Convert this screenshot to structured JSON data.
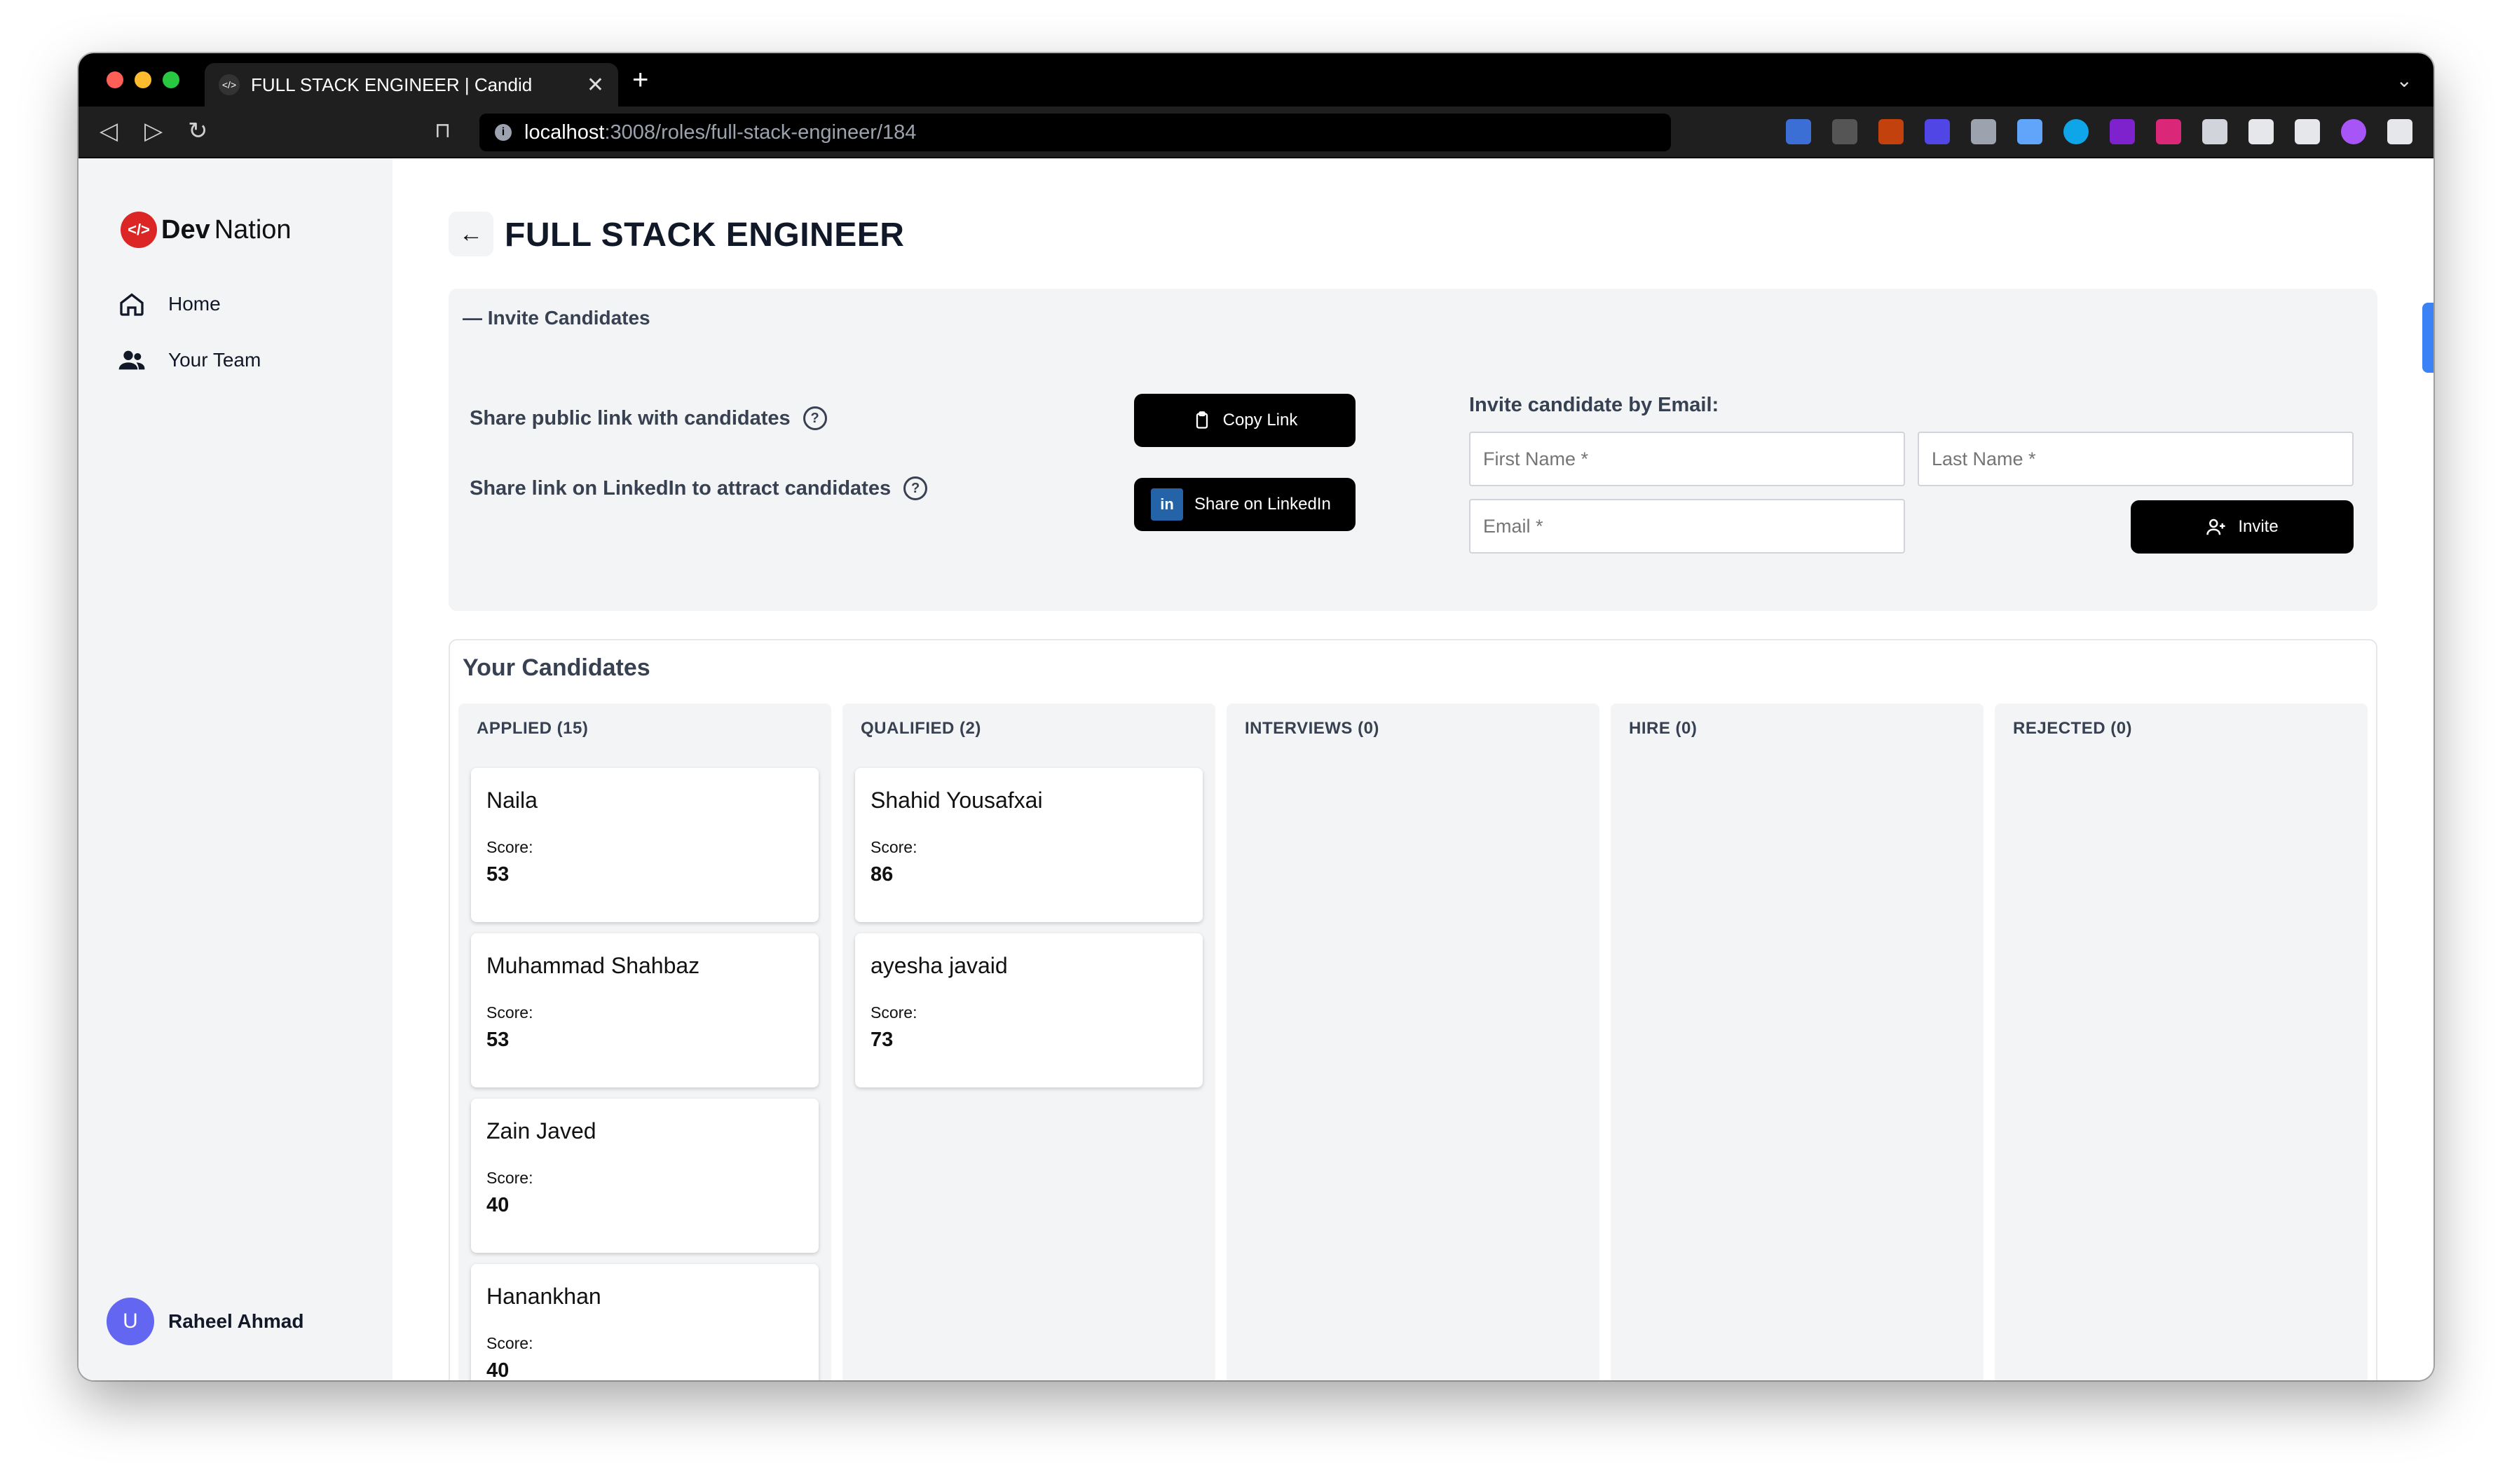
{
  "browser": {
    "tab_title": "FULL STACK ENGINEER | Candid",
    "tab_favicon": "</>",
    "tab_close": "✕",
    "new_tab": "+",
    "url_host": "localhost",
    "url_path": ":3008/roles/full-stack-engineer/184"
  },
  "sidebar": {
    "logo_mark": "</>",
    "logo_dev": "Dev",
    "logo_nation": "Nation",
    "items": [
      {
        "label": "Home",
        "icon": "home-icon"
      },
      {
        "label": "Your Team",
        "icon": "team-icon"
      }
    ],
    "user": {
      "initial": "U",
      "name": "Raheel Ahmad"
    }
  },
  "header": {
    "back_icon": "←",
    "title": "FULL STACK ENGINEER"
  },
  "invite": {
    "section_title": "— Invite Candidates",
    "share_public_label": "Share public link with candidates",
    "share_linkedin_label": "Share link on LinkedIn to attract candidates",
    "copy_link_label": "Copy Link",
    "linkedin_label": "Share on LinkedIn",
    "linkedin_badge": "in",
    "email_heading": "Invite candidate by Email:",
    "first_name_placeholder": "First Name *",
    "last_name_placeholder": "Last Name *",
    "email_placeholder": "Email *",
    "invite_label": "Invite",
    "help_glyph": "?"
  },
  "candidates": {
    "title": "Your Candidates",
    "score_label": "Score:",
    "columns": [
      {
        "title": "APPLIED (15)",
        "cards": [
          {
            "name": "Naila",
            "score": "53"
          },
          {
            "name": "Muhammad Shahbaz",
            "score": "53"
          },
          {
            "name": "Zain Javed",
            "score": "40"
          },
          {
            "name": "Hanankhan",
            "score": "40"
          }
        ]
      },
      {
        "title": "QUALIFIED (2)",
        "cards": [
          {
            "name": "Shahid Yousafxai",
            "score": "86"
          },
          {
            "name": "ayesha javaid",
            "score": "73"
          }
        ]
      },
      {
        "title": "INTERVIEWS (0)",
        "cards": []
      },
      {
        "title": "HIRE (0)",
        "cards": []
      },
      {
        "title": "REJECTED (0)",
        "cards": []
      }
    ]
  },
  "colors": {
    "accent": "#000000",
    "logo_red": "#dc2626",
    "avatar": "#6366f1",
    "linkedin": "#2563a8",
    "panel_bg": "#f3f4f6"
  }
}
